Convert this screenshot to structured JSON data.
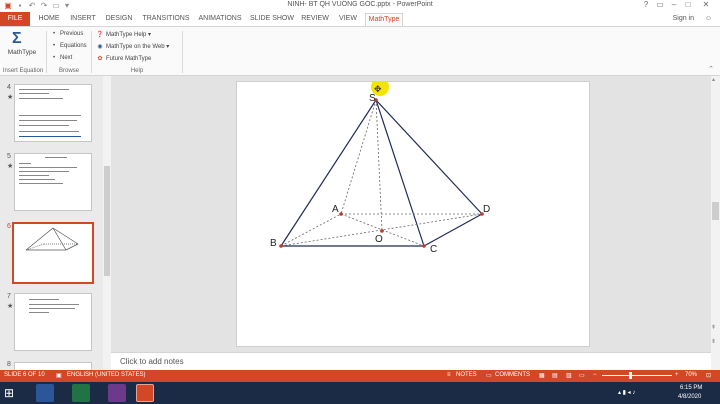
{
  "window": {
    "title": "NINH- BT QH VUÔNG GÓC.pptx - PowerPoint"
  },
  "tabs": [
    "FILE",
    "HOME",
    "INSERT",
    "DESIGN",
    "TRANSITIONS",
    "ANIMATIONS",
    "SLIDE SHOW",
    "REVIEW",
    "VIEW",
    "MathType"
  ],
  "signin": "Sign in",
  "ribbon": {
    "mathtype_button": "MathType",
    "insert_group": "Insert Equation",
    "browse_items": [
      "Previous",
      "Equations",
      "Next"
    ],
    "browse_group": "Browse",
    "help_items": [
      "MathType Help",
      "MathType on the Web",
      "Future MathType"
    ],
    "help_group": "Help"
  },
  "slides": [
    {
      "num": "4",
      "star": "★"
    },
    {
      "num": "5",
      "star": "★"
    },
    {
      "num": "6",
      "star": ""
    },
    {
      "num": "7",
      "star": "★"
    },
    {
      "num": "8",
      "star": ""
    }
  ],
  "diagram": {
    "labels": {
      "S": "S",
      "A": "A",
      "B": "B",
      "C": "C",
      "D": "D",
      "O": "O"
    }
  },
  "notes_placeholder": "Click to add notes",
  "status": {
    "slide": "SLIDE 6 OF 10",
    "language": "ENGLISH (UNITED STATES)",
    "notes": "NOTES",
    "comments": "COMMENTS",
    "zoom": "70%"
  },
  "taskbar": {
    "time": "6:15 PM",
    "date": "4/8/2020"
  },
  "colors": {
    "accent": "#d24726",
    "taskbar": "#1c2b45",
    "highlight": "#f5e300"
  }
}
